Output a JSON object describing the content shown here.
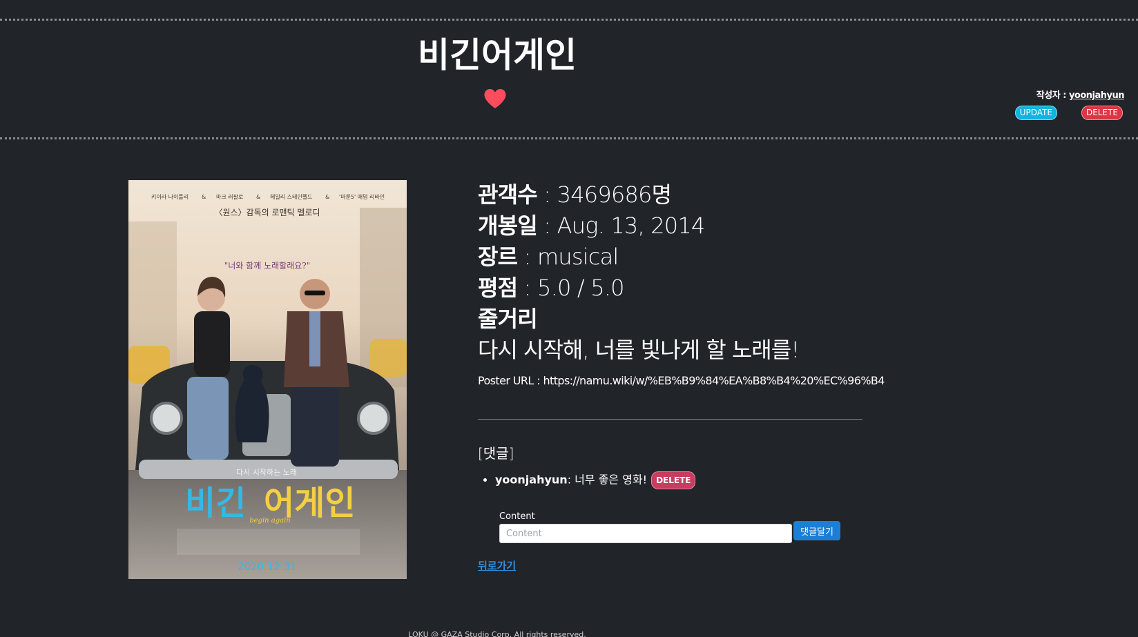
{
  "header": {
    "title": "비긴어게인",
    "author_label": "작성자 : ",
    "author_name": "yoonjahyun",
    "update_label": "UPDATE",
    "delete_label": "DELETE",
    "heart_color": "#ff4d5e"
  },
  "poster": {
    "credits": [
      "키이라 나이틀리",
      "&",
      "마크 러팔로",
      "&",
      "헤일리 스테인펠드",
      "&",
      "'마룬5' 애덤 리바인"
    ],
    "tagline_top": "〈원스〉감독의 로맨틱 멜로디",
    "quote": "\"너와 함께 노래할래요?\"",
    "small_title": "다시 시작하는 노래",
    "big_title_1": "비긴",
    "big_title_2": "어게인",
    "script_title": "begin again",
    "release_date": "2020.12.31"
  },
  "info": {
    "audience_label": "관객수",
    "audience_value": " : 3469686명",
    "release_label": "개봉일",
    "release_value": " : Aug. 13, 2014",
    "genre_label": "장르",
    "genre_value": " : musical",
    "rating_label": "평점",
    "rating_value": " : 5.0 / 5.0",
    "synopsis_label": "줄거리",
    "synopsis": "다시 시작해, 너를 빛나게 할 노래를!",
    "poster_url_label": "Poster URL : ",
    "poster_url": "https://namu.wiki/w/%EB%B9%84%EA%B8%B4%20%EC%96%B4"
  },
  "comments": {
    "heading": "[댓글]",
    "items": [
      {
        "user": "yoonjahyun",
        "text": ": 너무 좋은 영화!",
        "delete_label": "DELETE"
      }
    ],
    "content_label": "Content",
    "content_placeholder": "Content",
    "submit_label": "댓글달기"
  },
  "back_link": "뒤로가기",
  "footer": "LOKU @ GAZA Studio Corp. All rights reserved."
}
